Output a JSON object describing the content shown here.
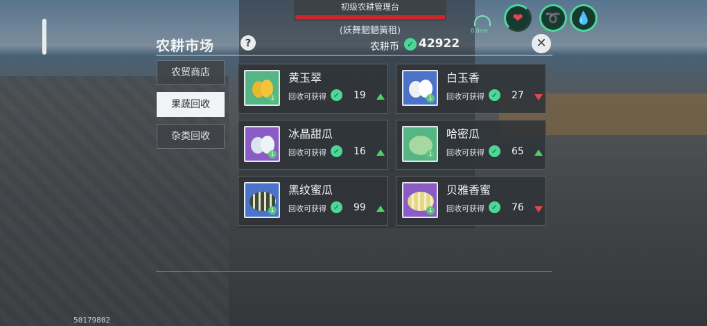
{
  "hud": {
    "banner_title": "初级农耕管理台",
    "banner_subtitle": "(妖舞魍魉簧租)",
    "signal_label": "0.8ms",
    "stat_icons": [
      "heart-icon",
      "stamina-icon",
      "water-drop-icon"
    ]
  },
  "market": {
    "title": "农耕市场",
    "help_label": "?",
    "currency_label": "农耕币",
    "currency_value": "42922",
    "tabs": [
      {
        "label": "农贸商店",
        "active": false
      },
      {
        "label": "果蔬回收",
        "active": true
      },
      {
        "label": "杂类回收",
        "active": false
      }
    ],
    "reward_label": "回收可获得",
    "items": [
      {
        "name": "黄玉翠",
        "value": "19",
        "trend": "up",
        "bg": "green"
      },
      {
        "name": "白玉香",
        "value": "27",
        "trend": "down",
        "bg": "blue"
      },
      {
        "name": "冰晶甜瓜",
        "value": "16",
        "trend": "up",
        "bg": "purple"
      },
      {
        "name": "哈密瓜",
        "value": "65",
        "trend": "up",
        "bg": "green"
      },
      {
        "name": "黑纹蜜瓜",
        "value": "99",
        "trend": "up",
        "bg": "blue"
      },
      {
        "name": "贝雅香蜜",
        "value": "76",
        "trend": "down",
        "bg": "purple"
      }
    ]
  },
  "footer": {
    "uid": "50179802"
  },
  "colors": {
    "accent": "#4ed69a",
    "up": "#4ed06a",
    "down": "#e0464a"
  }
}
